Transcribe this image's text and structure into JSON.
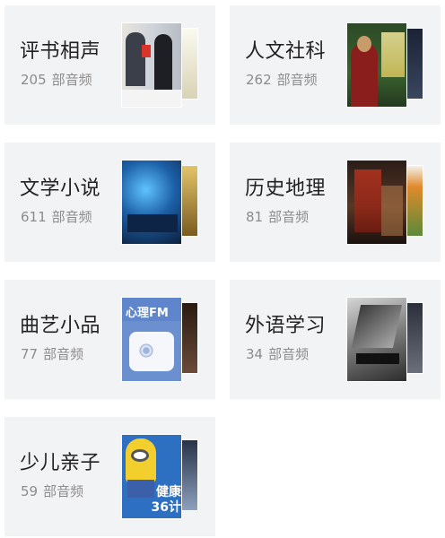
{
  "count_unit": "部音频",
  "categories": [
    {
      "title": "评书相声",
      "count": "205"
    },
    {
      "title": "人文社科",
      "count": "262"
    },
    {
      "title": "文学小说",
      "count": "611"
    },
    {
      "title": "历史地理",
      "count": "81"
    },
    {
      "title": "曲艺小品",
      "count": "77"
    },
    {
      "title": "外语学习",
      "count": "34"
    },
    {
      "title": "少儿亲子",
      "count": "59"
    }
  ],
  "cover_texts": {
    "quyi_front": "心理FM",
    "kids_front": "健康36计"
  }
}
